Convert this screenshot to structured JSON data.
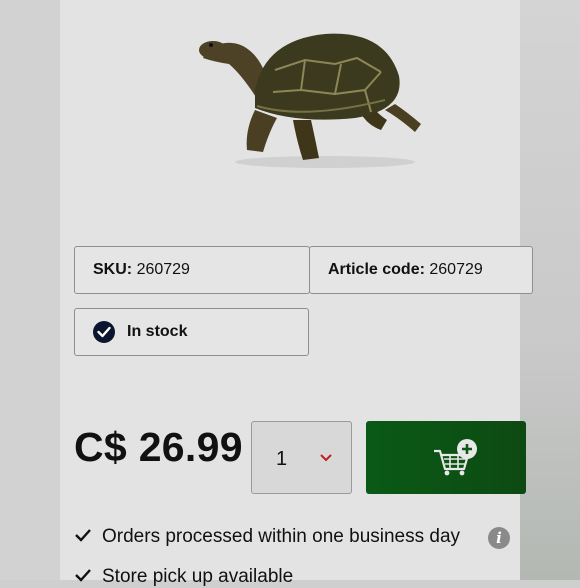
{
  "product": {
    "image_icon": "tortoise-figurine",
    "sku_label": "SKU:",
    "sku_value": "260729",
    "article_label": "Article code:",
    "article_value": "260729",
    "stock_status": "In stock",
    "price": "C$ 26.99",
    "quantity": "1"
  },
  "features": [
    {
      "text": "Orders processed within one business day"
    },
    {
      "text": "Store pick up available"
    }
  ],
  "colors": {
    "cart_button": "#0a5a16",
    "stock_badge": "#0b1530",
    "dropdown_chevron": "#c0201e"
  }
}
